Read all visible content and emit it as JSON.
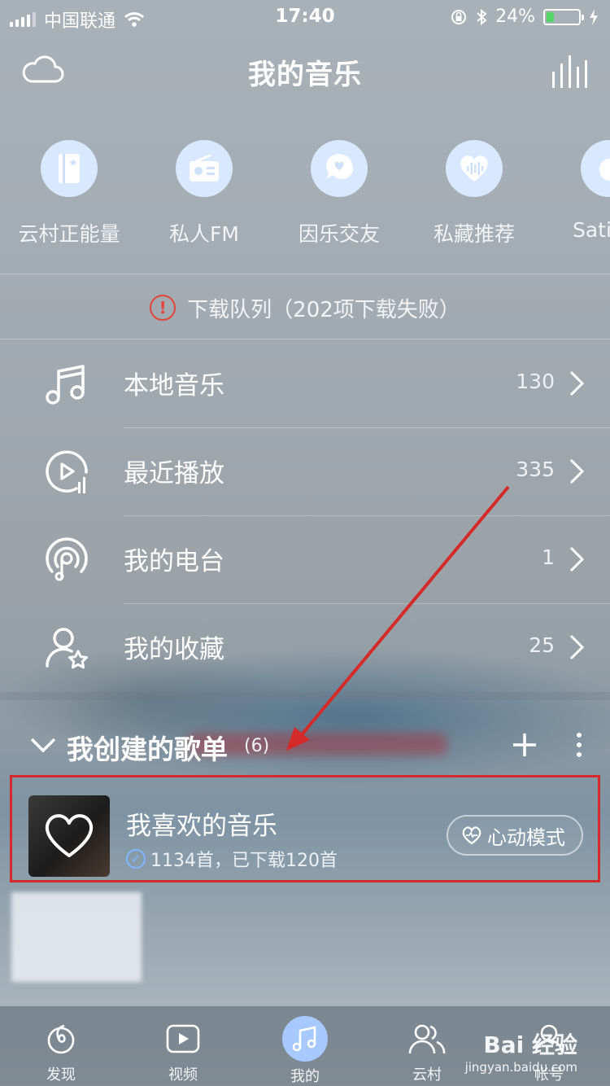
{
  "status": {
    "carrier": "中国联通",
    "time": "17:40",
    "battery": "24%",
    "battery_level": 0.24
  },
  "header": {
    "title": "我的音乐",
    "left_icon": "cloud-icon",
    "right_icon": "equalizer-icon"
  },
  "quick_actions": [
    {
      "label": "云村正能量",
      "icon": "book-star-icon"
    },
    {
      "label": "私人FM",
      "icon": "radio-icon"
    },
    {
      "label": "因乐交友",
      "icon": "chat-heart-icon"
    },
    {
      "label": "私藏推荐",
      "icon": "heart-wave-icon"
    },
    {
      "label": "Sati",
      "icon": "moon-star-icon"
    }
  ],
  "download_notice": "下载队列（202项下载失败）",
  "menu": [
    {
      "label": "本地音乐",
      "count": "130",
      "icon": "music-note-icon"
    },
    {
      "label": "最近播放",
      "count": "335",
      "icon": "recent-play-icon"
    },
    {
      "label": "我的电台",
      "count": "1",
      "icon": "podcast-icon"
    },
    {
      "label": "我的收藏",
      "count": "25",
      "icon": "user-star-icon"
    }
  ],
  "playlists": {
    "title": "我创建的歌单",
    "count": "(6)",
    "liked": {
      "name": "我喜欢的音乐",
      "meta": "1134首，已下载120首",
      "mode_button": "心动模式"
    }
  },
  "tabs": [
    {
      "label": "发现",
      "icon": "discover-icon",
      "active": false
    },
    {
      "label": "视频",
      "icon": "video-icon",
      "active": false
    },
    {
      "label": "我的",
      "icon": "music-icon",
      "active": true
    },
    {
      "label": "云村",
      "icon": "friends-icon",
      "active": false
    },
    {
      "label": "帐号",
      "icon": "account-icon",
      "active": false
    }
  ],
  "watermark": {
    "brand": "Bai 经验",
    "url": "jingyan.baidu.com"
  },
  "colors": {
    "annotation": "#d42a2a",
    "accent_circle": "#d8e8ff",
    "warning": "#e0463c",
    "battery": "#53d769"
  }
}
